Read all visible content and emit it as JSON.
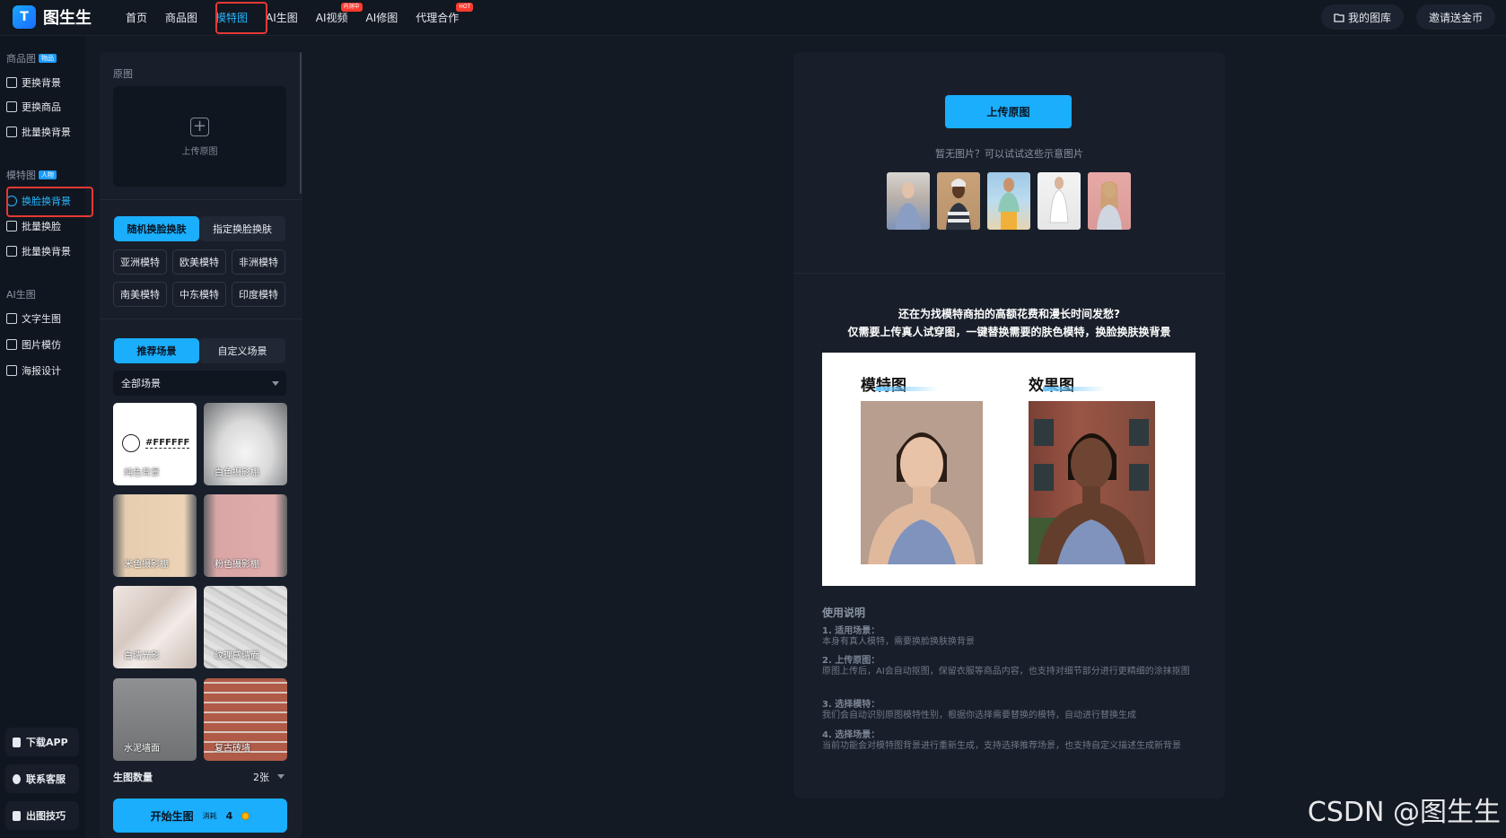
{
  "app": {
    "name": "图生生"
  },
  "nav": {
    "items": [
      {
        "label": "首页"
      },
      {
        "label": "商品图"
      },
      {
        "label": "模特图"
      },
      {
        "label": "AI生图"
      },
      {
        "label": "AI视频",
        "badge": "内测中"
      },
      {
        "label": "AI修图"
      },
      {
        "label": "代理合作",
        "badge": "HOT"
      }
    ],
    "active": "模特图"
  },
  "top_right": {
    "gallery": "我的图库",
    "invite": "邀请送金币"
  },
  "sidebar": {
    "sections": [
      {
        "title": "商品图",
        "tag": "物品",
        "items": [
          "更换背景",
          "更换商品",
          "批量换背景"
        ]
      },
      {
        "title": "模特图",
        "tag": "人物",
        "items": [
          "换脸换背景",
          "批量换脸",
          "批量换背景"
        ]
      },
      {
        "title": "AI生图",
        "items": [
          "文字生图",
          "图片模仿",
          "海报设计"
        ]
      }
    ],
    "active_item": "换脸换背景",
    "bottom": [
      "下载APP",
      "联系客服",
      "出图技巧"
    ]
  },
  "panel": {
    "original_label": "原图",
    "upload_text": "上传原图",
    "face_tabs": [
      "随机换脸换肤",
      "指定换脸换肤"
    ],
    "face_active": "随机换脸换肤",
    "model_types": [
      "亚洲模特",
      "欧美模特",
      "非洲模特",
      "南美模特",
      "中东模特",
      "印度模特"
    ],
    "scene_tabs": [
      "推荐场景",
      "自定义场景"
    ],
    "scene_active": "推荐场景",
    "scene_filter": "全部场景",
    "scenes": [
      {
        "label": "纯色背景",
        "code": "#FFFFFF"
      },
      {
        "label": "白色摄影棚"
      },
      {
        "label": "米色摄影棚"
      },
      {
        "label": "粉色摄影棚"
      },
      {
        "label": "白墙光影"
      },
      {
        "label": "纹理感墙面"
      },
      {
        "label": "水泥墙面"
      },
      {
        "label": "复古砖墙"
      }
    ],
    "count_label": "生图数量",
    "count_value": "2张",
    "start_label": "开始生图",
    "cost_label": "消耗",
    "cost_value": "4"
  },
  "main": {
    "upload_button": "上传原图",
    "hint": "暂无图片？可以试试这些示意图片",
    "promo_line1": "还在为找模特商拍的高额花费和漫长时间发愁?",
    "promo_line2": "仅需要上传真人试穿图，一键替换需要的肤色模特，换脸换肤换背景",
    "demo_left_title": "模特图",
    "demo_right_title": "效果图",
    "notes_title": "使用说明",
    "notes": [
      {
        "heading": "1. 适用场景：",
        "body": "本身有真人模特，需要换脸换肤换背景"
      },
      {
        "heading": "2. 上传原图：",
        "body": "原图上传后，AI会自动抠图，保留衣服等商品内容，也支持对细节部分进行更精细的涂抹抠图"
      },
      {
        "heading": "3. 选择模特：",
        "body": "我们会自动识别原图模特性别，根据你选择需要替换的模特，自动进行替换生成"
      },
      {
        "heading": "4. 选择场景：",
        "body": "当前功能会对模特图背景进行重新生成，支持选择推荐场景，也支持自定义描述生成新背景"
      }
    ]
  },
  "watermark": "CSDN @图生生"
}
